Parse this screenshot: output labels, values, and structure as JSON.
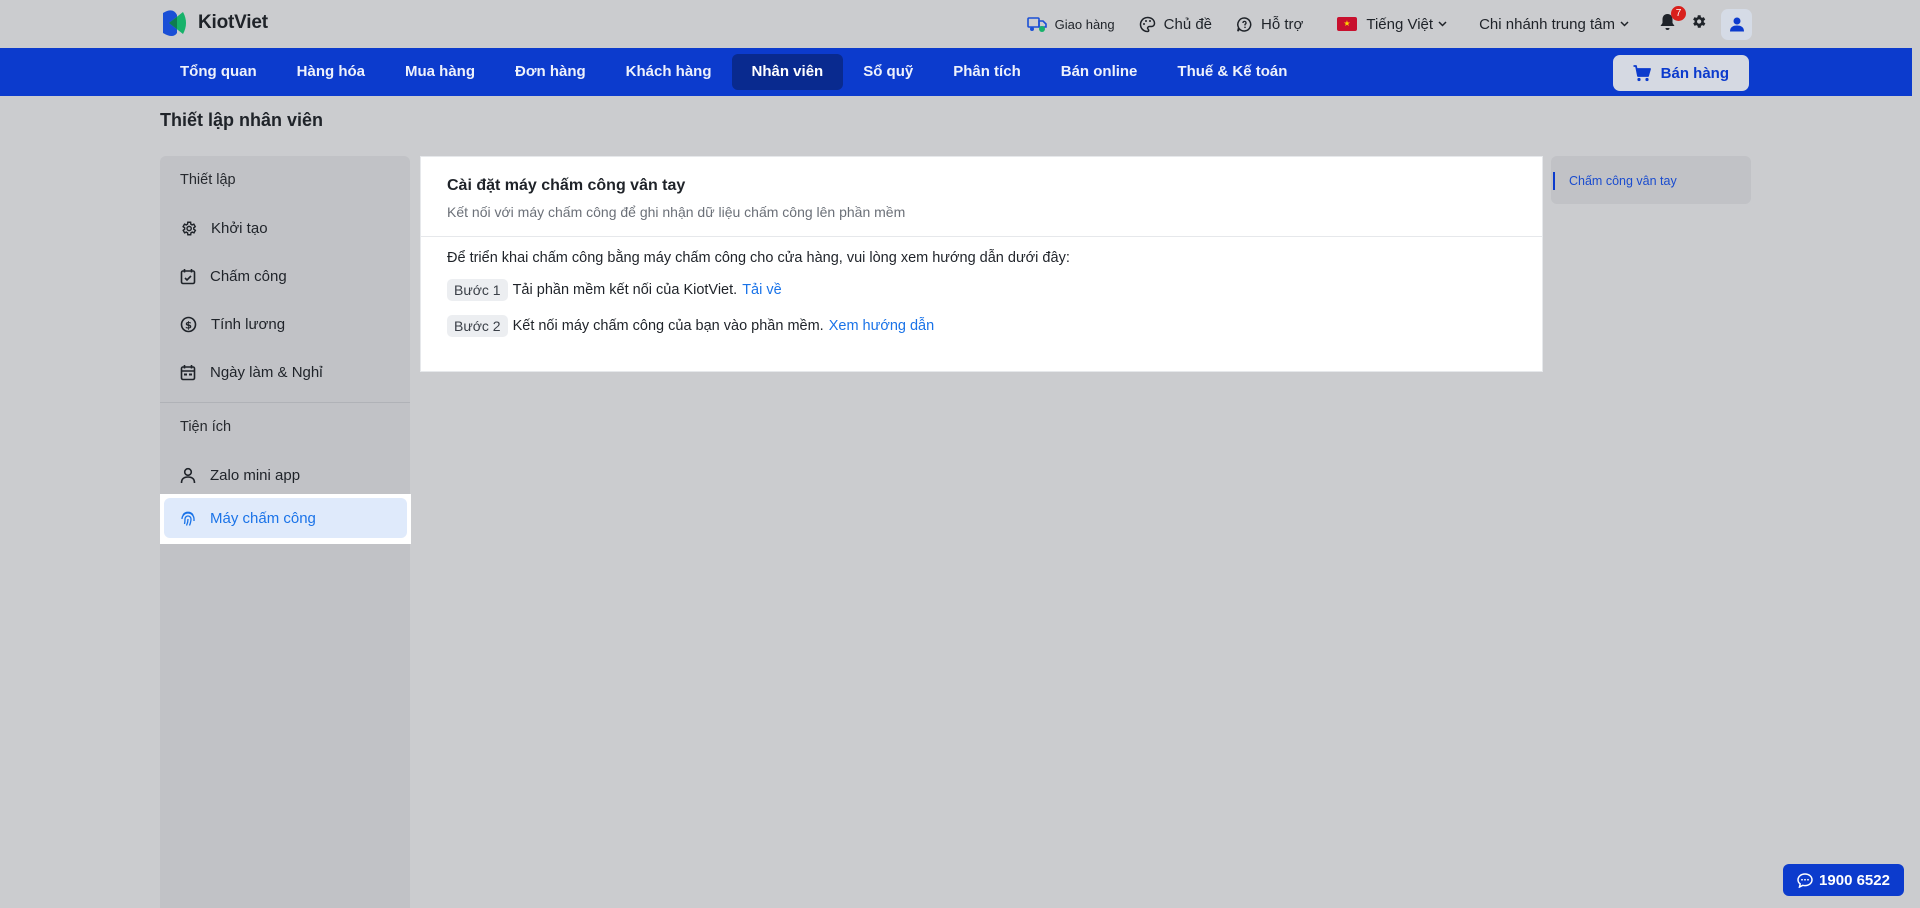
{
  "app": {
    "name": "KiotViet",
    "colors": {
      "primary": "#0c3bcd",
      "link": "#1a73e8",
      "badge": "#d9201c"
    }
  },
  "topbar": {
    "delivery": "Giao hàng",
    "theme": "Chủ đề",
    "support": "Hỗ trợ",
    "language": "Tiếng Việt",
    "branch": "Chi nhánh trung tâm",
    "notification_count": "7"
  },
  "nav": {
    "items": [
      "Tổng quan",
      "Hàng hóa",
      "Mua hàng",
      "Đơn hàng",
      "Khách hàng",
      "Nhân viên",
      "Sổ quỹ",
      "Phân tích",
      "Bán online",
      "Thuế & Kế toán"
    ],
    "active": "Nhân viên",
    "sell_button": "Bán hàng"
  },
  "page": {
    "title": "Thiết lập nhân viên"
  },
  "sidebar": {
    "section1": "Thiết lập",
    "items": [
      {
        "label": "Khởi tạo",
        "icon": "gear-icon"
      },
      {
        "label": "Chấm công",
        "icon": "calendar-check-icon"
      },
      {
        "label": "Tính lương",
        "icon": "dollar-circle-icon"
      },
      {
        "label": "Ngày làm & Nghỉ",
        "icon": "calendar-icon"
      }
    ],
    "section2": "Tiện ích",
    "items2": [
      {
        "label": "Zalo mini app",
        "icon": "user-icon"
      },
      {
        "label": "Máy chấm công",
        "icon": "fingerprint-icon"
      }
    ],
    "active": "Máy chấm công"
  },
  "card": {
    "title": "Cài đặt máy chấm công vân tay",
    "subtitle": "Kết nối với máy chấm công để ghi nhận dữ liệu chấm công lên phần mềm",
    "intro": "Để triển khai chấm công bằng máy chấm công cho cửa hàng, vui lòng xem hướng dẫn dưới đây:",
    "steps": [
      {
        "tag": "Bước 1",
        "text": "Tải phần mềm kết nối của KiotViet.",
        "link": "Tải về"
      },
      {
        "tag": "Bước 2",
        "text": "Kết nối máy chấm công của bạn vào phần mềm.",
        "link": "Xem hướng dẫn"
      }
    ]
  },
  "anchor": {
    "item": "Chấm công vân tay"
  },
  "hotline": {
    "number": "1900 6522"
  }
}
